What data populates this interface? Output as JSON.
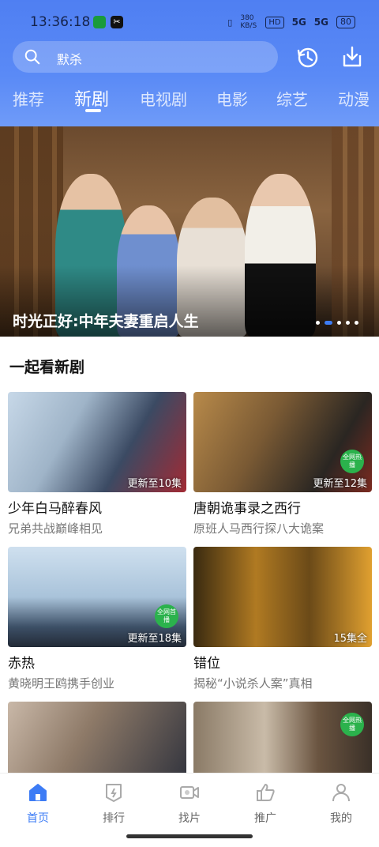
{
  "status_bar": {
    "time": "13:36:18",
    "speed": "380 KB/S",
    "hd": "HD",
    "signal1": "5G",
    "signal2": "5G",
    "battery": "80"
  },
  "search": {
    "placeholder": "默杀",
    "icon": "search-icon"
  },
  "header_actions": {
    "history_icon": "history-icon",
    "download_icon": "download-icon"
  },
  "tabs": [
    {
      "label": "推荐"
    },
    {
      "label": "新剧",
      "active": true
    },
    {
      "label": "电视剧"
    },
    {
      "label": "电影"
    },
    {
      "label": "综艺"
    },
    {
      "label": "动漫"
    }
  ],
  "banner": {
    "title": "时光正好:中年夫妻重启人生",
    "dot_count": 5,
    "active_dot": 1
  },
  "section": {
    "title": "一起看新剧"
  },
  "cards": [
    {
      "title": "少年白马醉春风",
      "desc": "兄弟共战巅峰相见",
      "badge": "更新至10集",
      "hot": false
    },
    {
      "title": "唐朝诡事录之西行",
      "desc": "原班人马西行探八大诡案",
      "badge": "更新至12集",
      "hot": true,
      "hot_label": "全网热播"
    },
    {
      "title": "赤热",
      "desc": "黄晓明王鸥携手创业",
      "badge": "更新至18集",
      "hot": true,
      "hot_label": "全网首播"
    },
    {
      "title": "错位",
      "desc": "揭秘“小说杀人案”真相",
      "badge": "15集全",
      "hot": false
    },
    {
      "title": "",
      "desc": "",
      "badge": "",
      "hot": false
    },
    {
      "title": "",
      "desc": "",
      "badge": "",
      "hot": true,
      "hot_label": "全网热播"
    }
  ],
  "bottom_nav": [
    {
      "label": "首页",
      "icon": "home-icon",
      "active": true
    },
    {
      "label": "排行",
      "icon": "ranking-icon"
    },
    {
      "label": "找片",
      "icon": "video-camera-icon"
    },
    {
      "label": "推广",
      "icon": "thumbs-up-icon"
    },
    {
      "label": "我的",
      "icon": "profile-icon"
    }
  ],
  "colors": {
    "accent": "#3d7cf5",
    "header": "#5a8af6"
  }
}
